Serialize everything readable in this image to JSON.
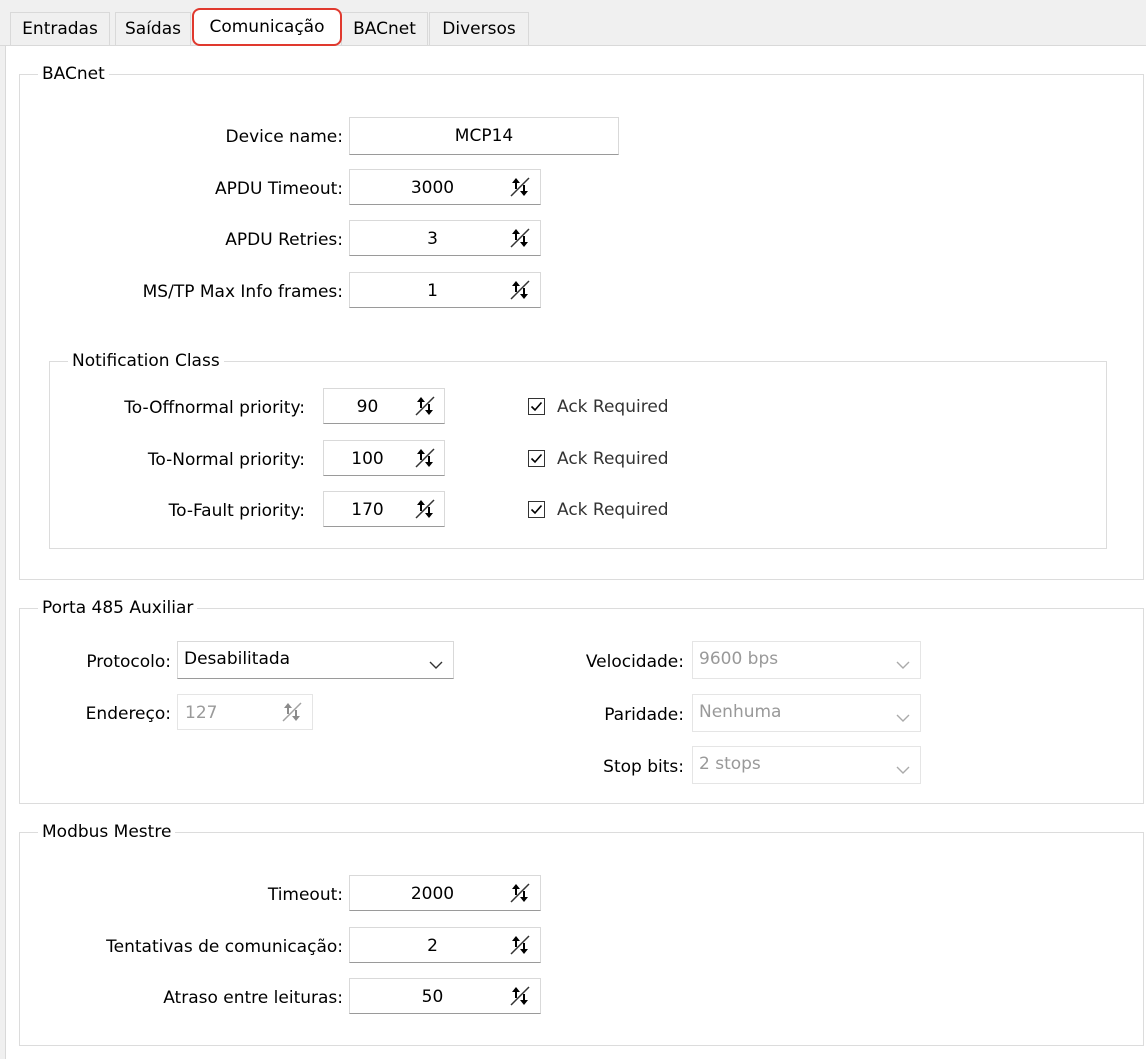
{
  "tabs": [
    {
      "label": "Entradas"
    },
    {
      "label": "Saídas"
    },
    {
      "label": "Comunicação"
    },
    {
      "label": "BACnet"
    },
    {
      "label": "Diversos"
    }
  ],
  "bacnet": {
    "title": "BACnet",
    "device_name_label": "Device name:",
    "device_name_value": "MCP14",
    "apdu_timeout_label": "APDU Timeout:",
    "apdu_timeout_value": "3000",
    "apdu_retries_label": "APDU Retries:",
    "apdu_retries_value": "3",
    "mstp_label": "MS/TP Max Info frames:",
    "mstp_value": "1",
    "notification": {
      "title": "Notification Class",
      "rows": [
        {
          "label": "To-Offnormal priority:",
          "value": "90",
          "ack": "Ack Required",
          "checked": true
        },
        {
          "label": "To-Normal priority:",
          "value": "100",
          "ack": "Ack Required",
          "checked": true
        },
        {
          "label": "To-Fault priority:",
          "value": "170",
          "ack": "Ack Required",
          "checked": true
        }
      ]
    }
  },
  "porta485": {
    "title": "Porta 485 Auxiliar",
    "protocolo_label": "Protocolo:",
    "protocolo_value": "Desabilitada",
    "endereco_label": "Endereço:",
    "endereco_value": "127",
    "velocidade_label": "Velocidade:",
    "velocidade_value": "9600 bps",
    "paridade_label": "Paridade:",
    "paridade_value": "Nenhuma",
    "stopbits_label": "Stop bits:",
    "stopbits_value": "2 stops"
  },
  "modbus": {
    "title": "Modbus Mestre",
    "timeout_label": "Timeout:",
    "timeout_value": "2000",
    "tentativas_label": "Tentativas de comunicação:",
    "tentativas_value": "2",
    "atraso_label": "Atraso entre leituras:",
    "atraso_value": "50"
  },
  "colors": {
    "active_tab_border": "#e0392e",
    "panel_bg": "#ffffff",
    "window_bg": "#f0f0f0"
  }
}
